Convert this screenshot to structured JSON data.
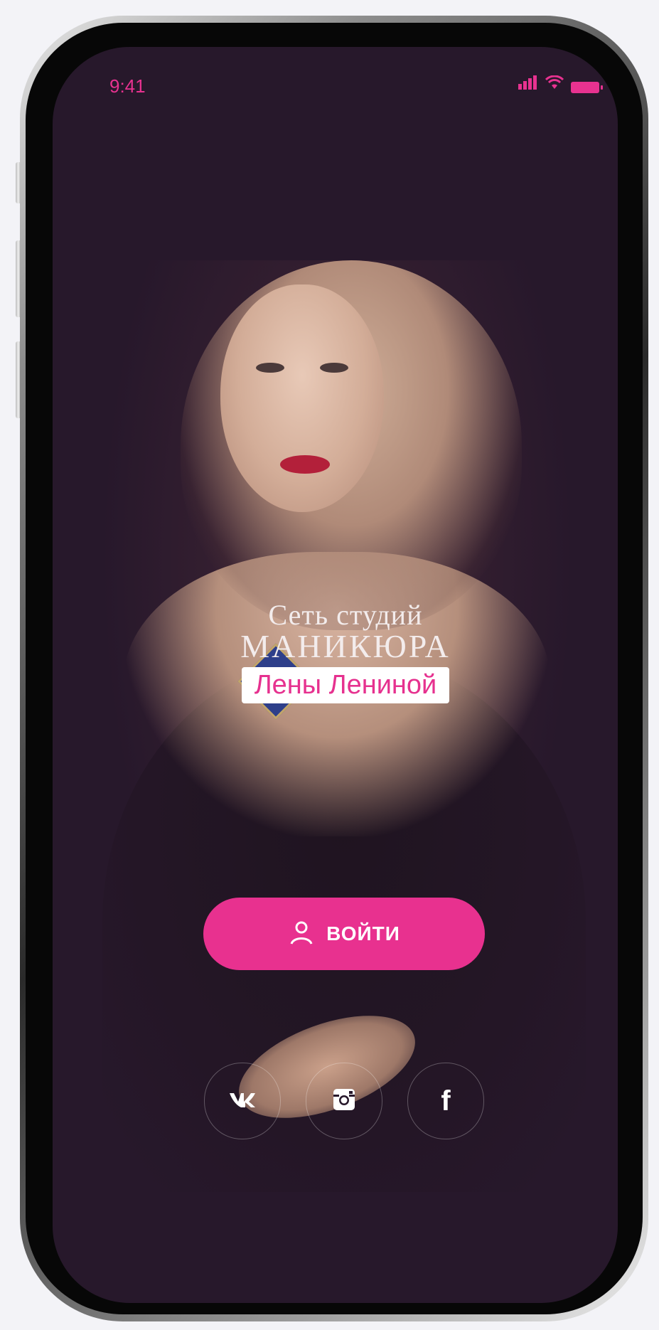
{
  "status_bar": {
    "time": "9:41",
    "accent": "#e83290"
  },
  "logo": {
    "line1": "Сеть студий",
    "line2": "МАНИКЮРА",
    "line3": "Лены Лениной"
  },
  "login_button": {
    "label": "ВОЙТИ",
    "color": "#e8318f"
  },
  "social": [
    {
      "icon": "vk-icon",
      "text": "ʬ"
    },
    {
      "icon": "instagram-icon",
      "text": ""
    },
    {
      "icon": "facebook-icon",
      "text": "f"
    }
  ]
}
